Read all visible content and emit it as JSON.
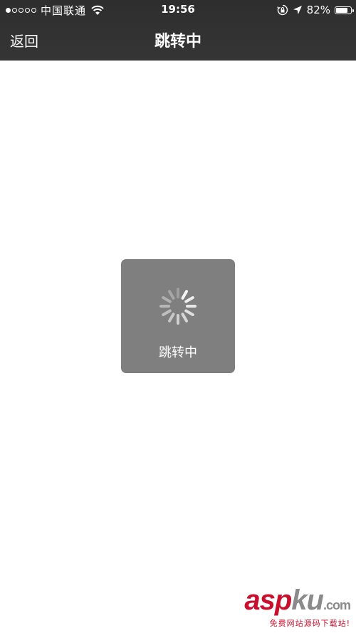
{
  "status_bar": {
    "signal_bars_filled": 1,
    "signal_bars_total": 5,
    "carrier": "中国联通",
    "time": "19:56",
    "battery_percent": "82%",
    "battery_level": 0.82,
    "icons": [
      "wifi-icon",
      "orientation-lock-icon",
      "location-arrow-icon",
      "battery-icon"
    ]
  },
  "nav_bar": {
    "back_label": "返回",
    "title": "跳转中"
  },
  "loading_toast": {
    "label": "跳转中",
    "icon": "spinner-icon"
  },
  "watermark": {
    "asp": "asp",
    "ku": "ku",
    "com": ".com",
    "subtitle": "免费网站源码下载站!"
  },
  "colors": {
    "nav_background": "#313132",
    "toast_background": "#807f80",
    "watermark_red": "#c8102e"
  }
}
